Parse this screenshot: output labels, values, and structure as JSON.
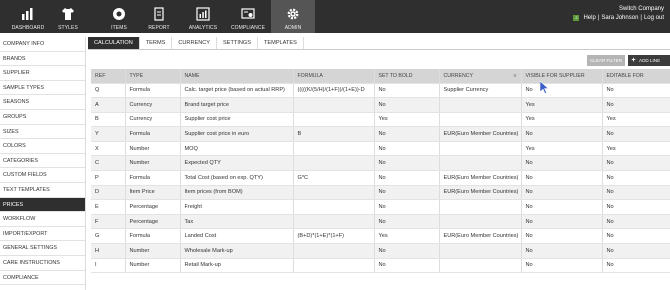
{
  "nav": {
    "items": [
      {
        "label": "DASHBOARD",
        "icon": "bar-chart-icon"
      },
      {
        "label": "STYLES",
        "icon": "shirt-icon"
      },
      {
        "label": "ITEMS",
        "icon": "items-circle-icon"
      },
      {
        "label": "REPORT",
        "icon": "document-icon"
      },
      {
        "label": "ANALYTICS",
        "icon": "analytics-icon"
      },
      {
        "label": "COMPLIANCE",
        "icon": "certificate-icon"
      },
      {
        "label": "ADMIN",
        "icon": "gear-icon"
      }
    ],
    "active": "ADMIN",
    "company": "Switch Company",
    "help": "Help",
    "user": "Sara Johnson",
    "logout": "Log out",
    "separator": "|"
  },
  "sidebar": {
    "items": [
      "COMPANY INFO",
      "BRANDS",
      "SUPPLIER",
      "SAMPLE TYPES",
      "SEASONS",
      "GROUPS",
      "SIZES",
      "COLORS",
      "CATEGORIES",
      "CUSTOM FIELDS",
      "TEXT TEMPLATES",
      "PRICES",
      "WORKFLOW",
      "IMPORT/EXPORT",
      "GENERAL SETTINGS",
      "CARE INSTRUCTIONS",
      "COMPLIANCE"
    ],
    "active": "PRICES"
  },
  "tabs": [
    "CALCULATION",
    "TERMS",
    "CURRENCY",
    "SETTINGS",
    "TEMPLATES"
  ],
  "actions": {
    "clear_filter": "CLEAR FILTER",
    "add_line": "ADD LINE"
  },
  "table": {
    "columns": [
      "REF",
      "TYPE",
      "NAME",
      "FORMULA",
      "SET TO BOLD",
      "CURRENCY",
      "VISIBLE FOR SUPPLIER",
      "EDITABLE FOR"
    ],
    "rows": [
      [
        "Q",
        "Formula",
        "Calc. target price (based on actual RRP)",
        "(((((K/(5/H)/(1+F))/(1+E))-D",
        "No",
        "Supplier Currency",
        "No",
        "No"
      ],
      [
        "A",
        "Currency",
        "Brand target price",
        "",
        "No",
        "",
        "Yes",
        "No"
      ],
      [
        "B",
        "Currency",
        "Supplier cost price",
        "",
        "Yes",
        "",
        "Yes",
        "Yes"
      ],
      [
        "Y",
        "Formula",
        "Supplier cost price in euro",
        "B",
        "No",
        "EUR(Euro Member Countries)",
        "No",
        "No"
      ],
      [
        "X",
        "Number",
        "MOQ",
        "",
        "No",
        "",
        "Yes",
        "Yes"
      ],
      [
        "C",
        "Number",
        "Expected QTY",
        "",
        "No",
        "",
        "No",
        "No"
      ],
      [
        "P",
        "Formula",
        "Total Cost (based on exp. QTY)",
        "G*C",
        "No",
        "EUR(Euro Member Countries)",
        "No",
        "No"
      ],
      [
        "D",
        "Item Price",
        "Item prices (from BOM)",
        "",
        "No",
        "EUR(Euro Member Countries)",
        "No",
        "No"
      ],
      [
        "E",
        "Percentage",
        "Freight",
        "",
        "No",
        "",
        "No",
        "No"
      ],
      [
        "F",
        "Percentage",
        "Tax",
        "",
        "No",
        "",
        "No",
        "No"
      ],
      [
        "G",
        "Formula",
        "Landed Cost",
        "(B+D)*(1+E)*(1+F)",
        "Yes",
        "EUR(Euro Member Countries)",
        "No",
        "No"
      ],
      [
        "H",
        "Number",
        "Wholesale Mark-up",
        "",
        "No",
        "",
        "No",
        "No"
      ],
      [
        "I",
        "Number",
        "Retail Mark-up",
        "",
        "No",
        "",
        "No",
        "No"
      ]
    ]
  },
  "colors": {
    "nav_bg": "#2f2f2f",
    "active_bg": "#2f2f2f",
    "header_bg": "#d5d5d5",
    "accent_green": "#5a9a3a"
  }
}
